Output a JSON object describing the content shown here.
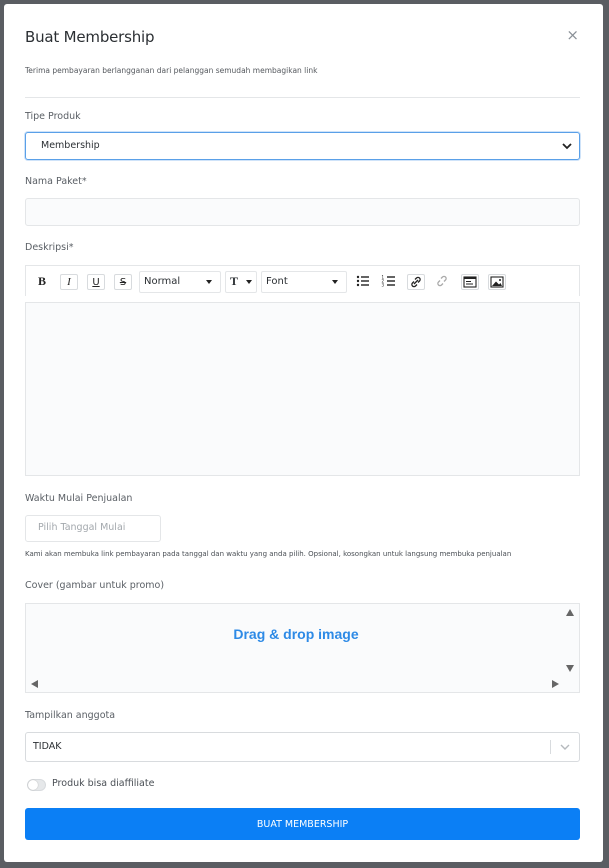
{
  "modal": {
    "title": "Buat Membership",
    "close": "×",
    "subtitle": "Terima pembayaran berlangganan dari pelanggan semudah membagikan link"
  },
  "product_type": {
    "label": "Tipe Produk",
    "value": "Membership"
  },
  "package_name": {
    "label": "Nama Paket*",
    "value": ""
  },
  "description": {
    "label": "Deskripsi*",
    "toolbar": {
      "bold": "B",
      "italic": "I",
      "underline": "U",
      "strike": "S",
      "heading": "Normal",
      "size_icon": "T",
      "font": "Font"
    },
    "value": ""
  },
  "sale_start": {
    "label": "Waktu Mulai Penjualan",
    "placeholder": "Pilih Tanggal Mulai",
    "hint": "Kami akan membuka link pembayaran pada tanggal dan waktu yang anda pilih. Opsional, kosongkan untuk langsung membuka penjualan"
  },
  "cover": {
    "label": "Cover (gambar untuk promo)",
    "drop_text": "Drag & drop image"
  },
  "show_members": {
    "label": "Tampilkan anggota",
    "value": "TIDAK"
  },
  "affiliate": {
    "label": "Produk bisa diaffiliate",
    "enabled": false
  },
  "submit": {
    "label": "BUAT MEMBERSHIP"
  },
  "colors": {
    "primary": "#0b7ff5",
    "link": "#2d8ae6"
  }
}
